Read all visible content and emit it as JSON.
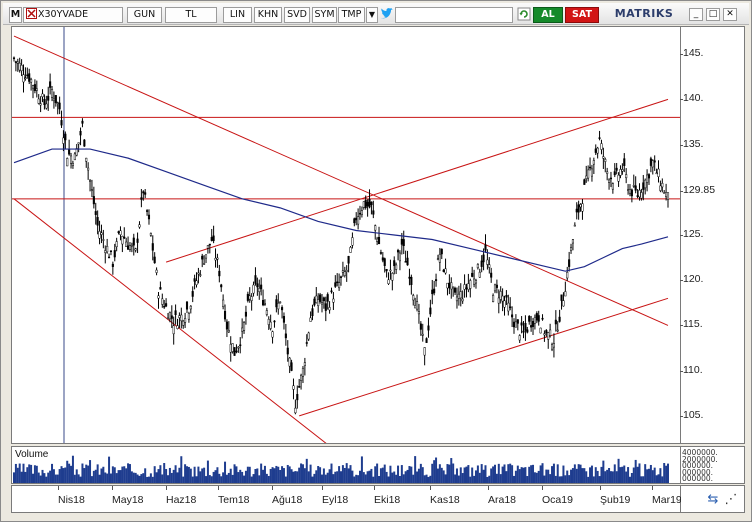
{
  "toolbar": {
    "menu_label": "M",
    "symbol": "X30YVADE",
    "period": "GUN",
    "currency": "TL",
    "scale": "LIN",
    "khn": "KHN",
    "svd": "SVD",
    "sym": "SYM",
    "tmp": "TMP",
    "buy_label": "AL",
    "sell_label": "SAT",
    "brand": "MATRIKS",
    "icons": [
      "symbol-x-icon",
      "dropdown-icon",
      "twitter-icon",
      "refresh-icon",
      "minimize-icon",
      "maximize-icon",
      "close-icon"
    ]
  },
  "panels": {
    "volume_title": "Volume"
  },
  "colors": {
    "candles": "#000000",
    "moving_average": "#1f2a8a",
    "trendlines": "#c81414",
    "volume_bars": "#1f3d8f",
    "buy": "#158a2a",
    "sell": "#d21515"
  },
  "chart_data": {
    "type": "candlestick",
    "y_ticks": [
      "145.",
      "140.",
      "135.",
      "129.85",
      "125.",
      "120.",
      "115.",
      "110.",
      "105."
    ],
    "ylim": [
      102,
      148
    ],
    "x_ticks": [
      "Nis18",
      "May18",
      "Haz18",
      "Tem18",
      "Ağu18",
      "Eyl18",
      "Eki18",
      "Kas18",
      "Ara18",
      "Oca19",
      "Şub19",
      "Mar19"
    ],
    "volume_ticks": [
      "4000000.",
      "2000000.",
      "000000.",
      "000000.",
      "000000."
    ],
    "last_price": 129.85,
    "horizontal_levels": [
      138.0,
      129.0
    ],
    "close_path": [
      [
        0,
        144.5
      ],
      [
        4,
        143.5
      ],
      [
        8,
        142.5
      ],
      [
        12,
        141.0
      ],
      [
        16,
        139.5
      ],
      [
        20,
        141.0
      ],
      [
        24,
        139.0
      ],
      [
        28,
        134.0
      ],
      [
        32,
        133.5
      ],
      [
        36,
        137.0
      ],
      [
        40,
        131.0
      ],
      [
        44,
        126.0
      ],
      [
        48,
        124.0
      ],
      [
        52,
        122.0
      ],
      [
        56,
        125.5
      ],
      [
        60,
        124.0
      ],
      [
        64,
        123.0
      ],
      [
        68,
        130.0
      ],
      [
        72,
        125.0
      ],
      [
        76,
        119.0
      ],
      [
        80,
        117.0
      ],
      [
        84,
        115.5
      ],
      [
        88,
        116.0
      ],
      [
        92,
        117.0
      ],
      [
        96,
        120.0
      ],
      [
        100,
        122.5
      ],
      [
        104,
        124.5
      ],
      [
        108,
        121.0
      ],
      [
        112,
        115.0
      ],
      [
        116,
        112.0
      ],
      [
        120,
        114.0
      ],
      [
        124,
        118.0
      ],
      [
        128,
        119.5
      ],
      [
        132,
        117.5
      ],
      [
        136,
        115.0
      ],
      [
        140,
        118.0
      ],
      [
        144,
        112.0
      ],
      [
        148,
        106.5
      ],
      [
        152,
        110.0
      ],
      [
        156,
        116.0
      ],
      [
        160,
        118.0
      ],
      [
        164,
        117.0
      ],
      [
        168,
        118.5
      ],
      [
        172,
        120.0
      ],
      [
        176,
        121.5
      ],
      [
        180,
        127.0
      ],
      [
        184,
        128.5
      ],
      [
        188,
        128.0
      ],
      [
        192,
        124.0
      ],
      [
        196,
        120.5
      ],
      [
        200,
        121.0
      ],
      [
        204,
        124.0
      ],
      [
        208,
        121.0
      ],
      [
        212,
        117.0
      ],
      [
        216,
        112.0
      ],
      [
        220,
        118.0
      ],
      [
        224,
        123.0
      ],
      [
        228,
        120.0
      ],
      [
        232,
        118.0
      ],
      [
        236,
        118.5
      ],
      [
        240,
        120.0
      ],
      [
        244,
        121.0
      ],
      [
        248,
        123.0
      ],
      [
        252,
        119.0
      ],
      [
        256,
        118.5
      ],
      [
        260,
        117.0
      ],
      [
        264,
        115.0
      ],
      [
        268,
        114.0
      ],
      [
        272,
        115.5
      ],
      [
        276,
        116.0
      ],
      [
        280,
        114.0
      ],
      [
        284,
        113.5
      ],
      [
        288,
        117.0
      ],
      [
        292,
        122.0
      ],
      [
        296,
        127.0
      ],
      [
        300,
        130.0
      ],
      [
        304,
        133.0
      ],
      [
        308,
        135.5
      ],
      [
        312,
        132.0
      ],
      [
        316,
        131.0
      ],
      [
        320,
        132.5
      ],
      [
        324,
        130.0
      ],
      [
        328,
        129.5
      ],
      [
        332,
        131.0
      ],
      [
        336,
        133.0
      ],
      [
        340,
        131.0
      ],
      [
        344,
        129.0
      ]
    ],
    "moving_average_path": [
      [
        0,
        133.0
      ],
      [
        20,
        134.5
      ],
      [
        40,
        134.5
      ],
      [
        60,
        133.5
      ],
      [
        80,
        132.0
      ],
      [
        100,
        130.5
      ],
      [
        120,
        129.0
      ],
      [
        140,
        128.0
      ],
      [
        160,
        126.5
      ],
      [
        180,
        125.5
      ],
      [
        200,
        125.0
      ],
      [
        220,
        124.5
      ],
      [
        240,
        123.5
      ],
      [
        260,
        122.5
      ],
      [
        280,
        121.5
      ],
      [
        290,
        121.0
      ],
      [
        300,
        121.5
      ],
      [
        310,
        122.5
      ],
      [
        320,
        123.5
      ],
      [
        330,
        124.0
      ],
      [
        344,
        124.8
      ]
    ],
    "trendlines": [
      {
        "from": [
          0,
          147
        ],
        "to": [
          344,
          115
        ]
      },
      {
        "from": [
          0,
          129
        ],
        "to": [
          170,
          101
        ]
      },
      {
        "from": [
          80,
          122
        ],
        "to": [
          344,
          140
        ]
      },
      {
        "from": [
          150,
          105
        ],
        "to": [
          344,
          118
        ]
      }
    ]
  }
}
